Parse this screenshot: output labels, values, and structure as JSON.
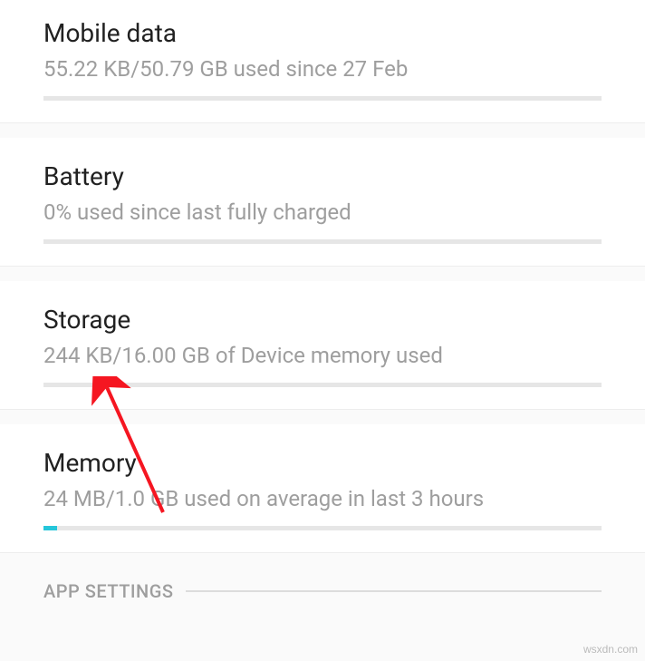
{
  "mobile_data": {
    "title": "Mobile data",
    "subtitle": "55.22 KB/50.79 GB used since 27 Feb",
    "progress_percent": 0
  },
  "battery": {
    "title": "Battery",
    "subtitle": "0% used since last fully charged",
    "progress_percent": 0
  },
  "storage": {
    "title": "Storage",
    "subtitle": "244 KB/16.00 GB of Device memory used",
    "progress_percent": 0
  },
  "memory": {
    "title": "Memory",
    "subtitle": "24 MB/1.0 GB used on average in last 3 hours",
    "progress_percent": 2.4
  },
  "app_settings_header": "APP SETTINGS",
  "watermark": "wsxdn.com",
  "colors": {
    "accent": "#26c6da",
    "annotation": "#f51621"
  }
}
